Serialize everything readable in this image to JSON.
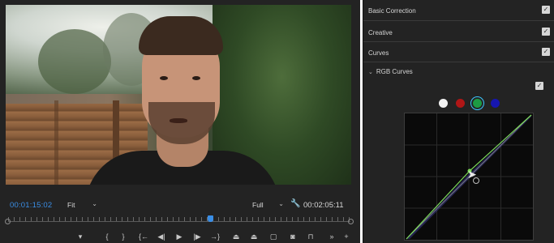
{
  "monitor": {
    "current_timecode": "00:01:15:02",
    "zoom_select": "Fit",
    "resolution_select": "Full",
    "duration_timecode": "00:02:05:11",
    "playhead_position": 0.59,
    "settings_icon": "wrench-icon",
    "transport_icons": [
      "marker-icon",
      "in-point-icon",
      "out-point-icon",
      "go-to-in-icon",
      "step-back-icon",
      "play-icon",
      "step-forward-icon",
      "go-to-out-icon",
      "lift-icon",
      "extract-icon",
      "safe-margins-icon",
      "export-frame-icon",
      "comparison-view-icon",
      "more-icon",
      "add-button-icon"
    ],
    "transport_glyphs": [
      "▾",
      "{",
      "}",
      "{←",
      "◀|",
      "▶",
      "|▶",
      "→}",
      "⏏",
      "⏏",
      "▢",
      "◙",
      "⊓",
      "»",
      "+"
    ]
  },
  "lumetri": {
    "sections": [
      {
        "label": "Basic Correction",
        "enabled": true
      },
      {
        "label": "Creative",
        "enabled": true
      },
      {
        "label": "Curves",
        "enabled": true
      }
    ],
    "rgb_curves": {
      "label": "RGB Curves",
      "enabled": true,
      "channels": [
        {
          "name": "white",
          "color": "#f2f2f2"
        },
        {
          "name": "red",
          "color": "#b01616"
        },
        {
          "name": "green",
          "color": "#1d9a43",
          "selected": true
        },
        {
          "name": "blue",
          "color": "#1616b0"
        }
      ],
      "green_curve_color": "#7ddc5a"
    }
  }
}
